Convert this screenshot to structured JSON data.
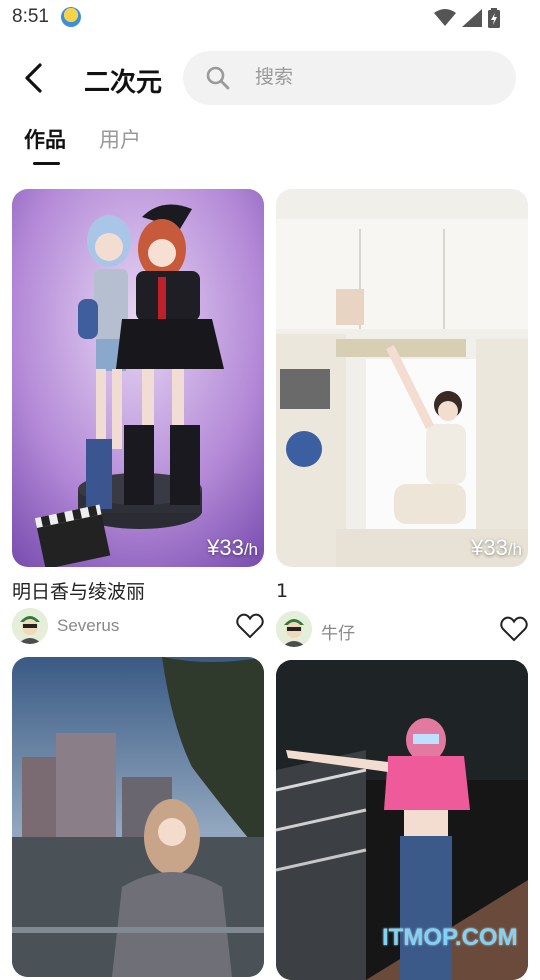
{
  "status": {
    "time": "8:51"
  },
  "header": {
    "title": "二次元",
    "search_placeholder": "搜索"
  },
  "tabs": [
    {
      "label": "作品"
    },
    {
      "label": "用户"
    }
  ],
  "cards": [
    {
      "title": "明日香与绫波丽",
      "price": "¥33",
      "unit": "/h",
      "author": "Severus"
    },
    {
      "title": "1",
      "price": "¥33",
      "unit": "/h",
      "author": "牛仔"
    },
    {
      "title": "",
      "price": "",
      "unit": "",
      "author": ""
    },
    {
      "title": "",
      "price": "",
      "unit": "",
      "author": ""
    }
  ],
  "watermark": "ITMOP.COM"
}
